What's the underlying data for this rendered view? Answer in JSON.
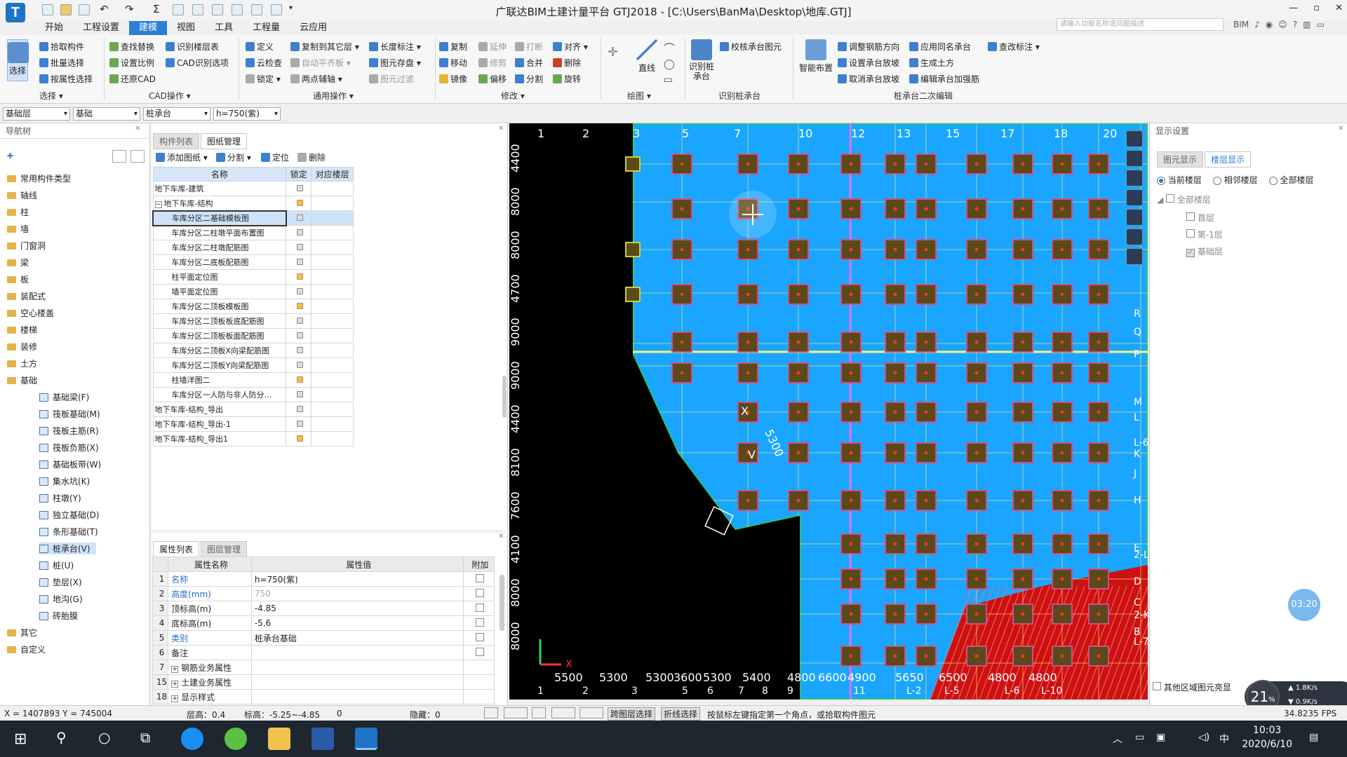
{
  "app": {
    "title": "广联达BIM土建计量平台 GTJ2018 - [C:\\Users\\BanMa\\Desktop\\地库.GTJ]",
    "logo": "T",
    "search_placeholder": "请输入功能名称或问题描述",
    "window_controls": [
      "—",
      "▫",
      "✕"
    ]
  },
  "menu": [
    "开始",
    "工程设置",
    "建模",
    "视图",
    "工具",
    "工程量",
    "云应用"
  ],
  "menu_active": "建模",
  "ribbon": {
    "select_label": "选择",
    "select_group": "选择 ▾",
    "select_items": [
      "拾取构件",
      "批量选择",
      "按属性选择"
    ],
    "cad_items": [
      "查找替换",
      "设置比例",
      "还原CAD",
      "识别楼层表",
      "CAD识别选项"
    ],
    "cad_group": "CAD操作 ▾",
    "common_items": [
      "定义",
      "云检查",
      "锁定 ▾",
      "复制到其它层 ▾",
      "自动平齐板 ▾",
      "两点辅轴 ▾",
      "长度标注 ▾",
      "图元存盘 ▾",
      "图元过滤"
    ],
    "common_group": "通用操作 ▾",
    "modify_items": [
      "复制",
      "移动",
      "镜像",
      "延伸",
      "修剪",
      "偏移",
      "打断",
      "合并",
      "分割",
      "对齐 ▾",
      "删除",
      "旋转"
    ],
    "modify_group": "修改 ▾",
    "draw_items": [
      "直线"
    ],
    "draw_group": "绘图 ▾",
    "identify_items": [
      "识别桩承台",
      "校核承台图元"
    ],
    "identify_group": "识别桩承台",
    "smart_label": "智能布置",
    "pile_items": [
      "调整钢筋方向",
      "设置承台放坡",
      "取消承台放坡",
      "应用同名承台",
      "生成土方",
      "编辑承台加强筋",
      "查改标注 ▾"
    ],
    "pile_group": "桩承台二次编辑"
  },
  "toolbar2": {
    "floor": "基础层",
    "type": "基础",
    "component": "桩承台",
    "spec": "h=750(紫)"
  },
  "nav": {
    "header": "导航树",
    "items": [
      "常用构件类型",
      "轴线",
      "柱",
      "墙",
      "门窗洞",
      "梁",
      "板",
      "装配式",
      "空心楼盖",
      "楼梯",
      "装修",
      "土方",
      "基础"
    ],
    "sub_items": [
      "基础梁(F)",
      "筏板基础(M)",
      "筏板主筋(R)",
      "筏板负筋(X)",
      "基础板带(W)",
      "集水坑(K)",
      "柱墩(Y)",
      "独立基础(D)",
      "条形基础(T)",
      "桩承台(V)",
      "桩(U)",
      "垫层(X)",
      "地沟(G)",
      "砖胎膜"
    ],
    "sub_active": "桩承台(V)",
    "tail_items": [
      "其它",
      "自定义"
    ]
  },
  "drawings": {
    "tabs": [
      "构件列表",
      "图纸管理"
    ],
    "active_tab": "图纸管理",
    "toolbar": [
      "添加图纸 ▾",
      "分割 ▾",
      "定位",
      "删除"
    ],
    "columns": [
      "名称",
      "锁定",
      "对应楼层"
    ],
    "rows": [
      {
        "name": "地下车库-建筑",
        "lock": "closed",
        "indent": 0
      },
      {
        "name": "地下车库-结构",
        "lock": "open",
        "indent": 0,
        "toggle": "−"
      },
      {
        "name": "车库分区二基础模板图",
        "lock": "closed",
        "indent": 2,
        "selected": true
      },
      {
        "name": "车库分区二柱墩平面布置图",
        "lock": "closed",
        "indent": 2
      },
      {
        "name": "车库分区二柱墩配筋图",
        "lock": "closed",
        "indent": 2
      },
      {
        "name": "车库分区二底板配筋图",
        "lock": "closed",
        "indent": 2
      },
      {
        "name": "柱平面定位图",
        "lock": "open",
        "indent": 2
      },
      {
        "name": "墙平面定位图",
        "lock": "closed",
        "indent": 2
      },
      {
        "name": "车库分区二顶板模板图",
        "lock": "open",
        "indent": 2
      },
      {
        "name": "车库分区二顶板板底配筋图",
        "lock": "closed",
        "indent": 2
      },
      {
        "name": "车库分区二顶板板面配筋图",
        "lock": "closed",
        "indent": 2
      },
      {
        "name": "车库分区二顶板X向梁配筋图",
        "lock": "closed",
        "indent": 2
      },
      {
        "name": "车库分区二顶板Y向梁配筋图",
        "lock": "closed",
        "indent": 2
      },
      {
        "name": "柱墙洋图二",
        "lock": "open",
        "indent": 2
      },
      {
        "name": "车库分区一人防与非人防分...",
        "lock": "closed",
        "indent": 2
      },
      {
        "name": "地下车库-结构_导出",
        "lock": "closed",
        "indent": 0
      },
      {
        "name": "地下车库-结构_导出-1",
        "lock": "closed",
        "indent": 0
      },
      {
        "name": "地下车库-结构_导出1",
        "lock": "open",
        "indent": 0
      }
    ]
  },
  "properties": {
    "tabs": [
      "属性列表",
      "图层管理"
    ],
    "active_tab": "属性列表",
    "columns": [
      "",
      "属性名称",
      "属性值",
      "附加"
    ],
    "rows": [
      {
        "num": "1",
        "name": "名称",
        "value": "h=750(紫)",
        "blue": true,
        "check": true
      },
      {
        "num": "2",
        "name": "高度(mm)",
        "value": "750",
        "blue": true,
        "grey": true,
        "check": false
      },
      {
        "num": "3",
        "name": "顶标高(m)",
        "value": "-4.85",
        "check": true
      },
      {
        "num": "4",
        "name": "底标高(m)",
        "value": "-5.6",
        "check": true
      },
      {
        "num": "5",
        "name": "类别",
        "value": "桩承台基础",
        "blue": true,
        "check": true
      },
      {
        "num": "6",
        "name": "备注",
        "value": "",
        "check": true
      },
      {
        "num": "7",
        "name": "钢筋业务属性",
        "value": "",
        "expand": true
      },
      {
        "num": "15",
        "name": "土建业务属性",
        "value": "",
        "expand": true
      },
      {
        "num": "18",
        "name": "显示样式",
        "value": "",
        "expand": true
      }
    ]
  },
  "canvas": {
    "top_axis": [
      "1",
      "2",
      "3",
      "5",
      "7",
      "10",
      "12",
      "13",
      "15",
      "17",
      "18",
      "20"
    ],
    "bottom_axis": [
      "1",
      "2",
      "3",
      "5",
      "6",
      "7",
      "8",
      "9",
      "11",
      "L-2",
      "L-5",
      "L-6",
      "L-10"
    ],
    "bottom_dims": [
      "5500",
      "5300",
      "5300",
      "3600",
      "5300",
      "5400",
      "4800",
      "6600",
      "4900",
      "5650",
      "6500",
      "4800",
      "4800"
    ],
    "right_axis": [
      "R",
      "Q",
      "P",
      "M",
      "L",
      "L-6",
      "K",
      "J",
      "H",
      "E",
      "2-L",
      "D",
      "C",
      "2-K",
      "B",
      "L-7"
    ],
    "left_dims": [
      "4400",
      "8000",
      "8000",
      "4700",
      "9000",
      "9000",
      "4400",
      "8100",
      "7600",
      "4100",
      "8000",
      "8000"
    ],
    "dim_5300": "5300",
    "label_x": "X",
    "label_v": "V",
    "ucs_x": "X",
    "colors": {
      "floor": "#1aa6ff",
      "grid": "#fff27a",
      "pile": "#5a4a1a",
      "pile_border": "#d24b8c",
      "hatch": "#cc1111",
      "edge": "#1fd15a"
    }
  },
  "display": {
    "header": "显示设置",
    "tabs": [
      "图元显示",
      "楼层显示"
    ],
    "active_tab": "楼层显示",
    "radios": [
      "当前楼层",
      "相邻楼层",
      "全部楼层"
    ],
    "radio_selected": "当前楼层",
    "tree_root": "全部楼层",
    "floors": [
      {
        "name": "首层",
        "checked": false
      },
      {
        "name": "第-1层",
        "checked": false
      },
      {
        "name": "基础层",
        "checked": true
      }
    ],
    "bottom_check": "其他区域图元亮显",
    "timer": "03:20"
  },
  "status": {
    "coords": "X = 1407893 Y = 745004",
    "floor_height": "层高：0.4",
    "elevation": "标高：-5.25~-4.85",
    "zero": "0",
    "hidden": "隐藏：0",
    "mode1": "跨图层选择",
    "mode2": "折线选择",
    "hint": "按鼠标左键指定第一个角点，或拾取构件图元",
    "fps": "34.8235 FPS"
  },
  "speed": {
    "percent": "21",
    "unit": "%",
    "up": "1.8K/s",
    "down": "0.9K/s"
  },
  "taskbar": {
    "time": "10:03",
    "date": "2020/6/10",
    "ime": "中"
  }
}
